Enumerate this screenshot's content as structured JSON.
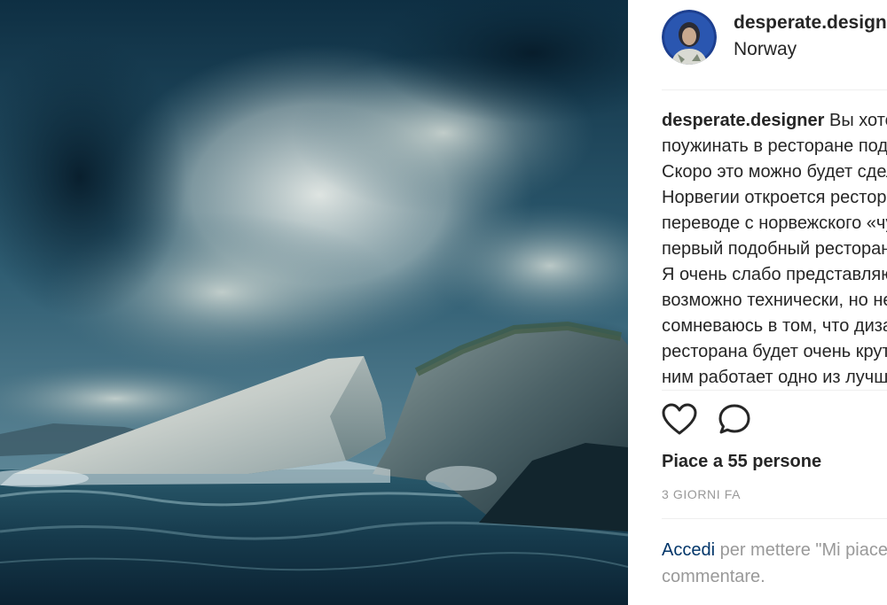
{
  "post": {
    "username": "desperate.designer",
    "location": "Norway",
    "caption_lines": [
      "Вы хотели бы",
      "поужинать в ресторане под водой?",
      "Скоро это можно будет сделать — в",
      "Норвегии откроется ресторан Under (в",
      "переводе с норвежского «чудо») —",
      "первый подобный ресторан в Европе.",
      "Я очень слабо представляю, как это",
      "возможно технически, но не",
      "сомневаюсь в том, что дизайн",
      "ресторана будет очень крутой — ведь над",
      "ним работает одно из лучших бюро"
    ],
    "likes": "Piace a 55 persone",
    "time_ago": "3 GIORNI FA",
    "login_link": "Accedi",
    "login_text_1": " per mettere \"Mi piace\" o",
    "login_text_2": "commentare."
  },
  "colors": {
    "text": "#262626",
    "muted": "#999999",
    "link": "#003569",
    "divider": "#efefef"
  },
  "icons": {
    "like": "heart-outline",
    "comment": "speech-bubble-outline"
  }
}
